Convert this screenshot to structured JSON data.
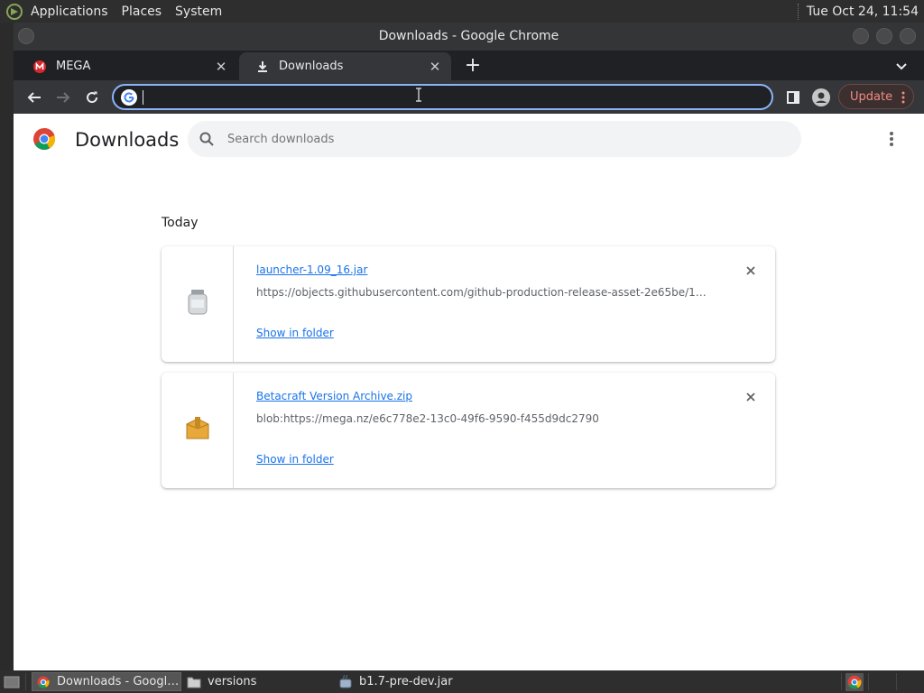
{
  "system_panel": {
    "menus": [
      "Applications",
      "Places",
      "System"
    ],
    "clock": "Tue Oct 24, 11:54"
  },
  "window": {
    "title": "Downloads - Google Chrome"
  },
  "tabs": [
    {
      "label": "MEGA",
      "icon": "mega-icon",
      "active": false
    },
    {
      "label": "Downloads",
      "icon": "download-icon",
      "active": true
    }
  ],
  "toolbar": {
    "omnibox_value": "",
    "update_label": "Update"
  },
  "downloads_page": {
    "title": "Downloads",
    "search_placeholder": "Search downloads",
    "section": "Today",
    "items": [
      {
        "filename": "launcher-1.09_16.jar",
        "url": "https://objects.githubusercontent.com/github-production-release-asset-2e65be/157…",
        "action": "Show in folder",
        "icon": "jar-file-icon"
      },
      {
        "filename": "Betacraft Version Archive.zip",
        "url": "blob:https://mega.nz/e6c778e2-13c0-49f6-9590-f455d9dc2790",
        "action": "Show in folder",
        "icon": "archive-file-icon"
      }
    ]
  },
  "taskbar": {
    "items": [
      {
        "label": "Downloads - Googl…",
        "icon": "chrome-icon",
        "active": true
      },
      {
        "label": "versions",
        "icon": "folder-icon",
        "active": false
      },
      {
        "label": "b1.7-pre-dev.jar",
        "icon": "java-icon",
        "active": false
      }
    ]
  },
  "colors": {
    "accent": "#1a73e8",
    "omnibox_focus": "#8ab4f8",
    "update": "#f28b82"
  }
}
